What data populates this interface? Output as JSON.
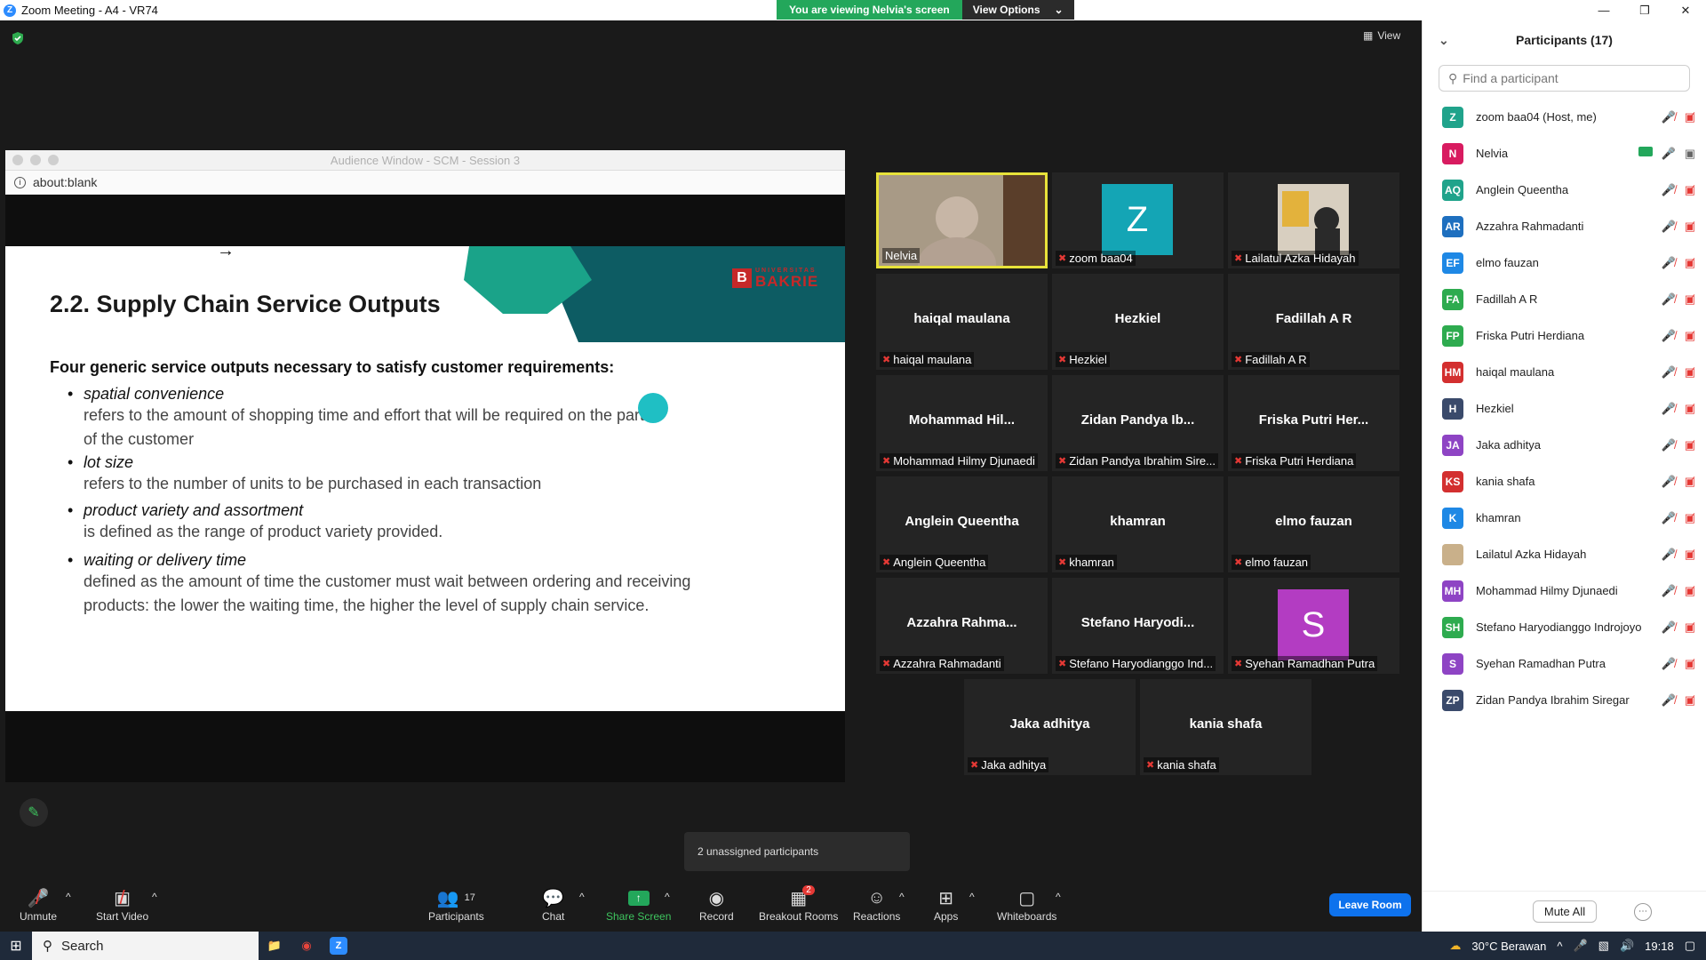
{
  "window": {
    "title": "Zoom Meeting - A4 - VR74"
  },
  "banner": {
    "viewing": "You are viewing Nelvia's screen",
    "options": "View Options"
  },
  "stage": {
    "view_label": "View"
  },
  "audience": {
    "title": "Audience Window - SCM - Session 3",
    "url": "about:blank"
  },
  "slide": {
    "title": "2.2. Supply Chain Service Outputs",
    "subtitle": "Four generic service outputs necessary to satisfy customer requirements:",
    "logo_small": "UNIVERSITAS",
    "logo_word": "BAKRIE",
    "bullets": [
      {
        "head": "spatial convenience",
        "body1": "refers to the amount of shopping time and effort that will be required on the part",
        "body2": "of the customer"
      },
      {
        "head": "lot size",
        "body1": "refers to the number of units to be purchased in each transaction",
        "body2": ""
      },
      {
        "head": "product variety and assortment",
        "body1": "is defined as the range of product variety provided.",
        "body2": ""
      },
      {
        "head": "waiting or delivery time",
        "body1": "defined as the amount of time the customer must wait between ordering and receiving",
        "body2": "products: the lower the waiting time, the higher the level of supply chain service."
      }
    ]
  },
  "tiles": [
    {
      "big": "",
      "label": "Nelvia"
    },
    {
      "big": "Z",
      "label": "zoom baa04"
    },
    {
      "big": "",
      "label": "Lailatul Azka Hidayah"
    },
    {
      "big": "haiqal maulana",
      "label": "haiqal maulana"
    },
    {
      "big": "Hezkiel",
      "label": "Hezkiel"
    },
    {
      "big": "Fadillah A R",
      "label": "Fadillah A R"
    },
    {
      "big": "Mohammad  Hil...",
      "label": "Mohammad Hilmy Djunaedi"
    },
    {
      "big": "Zidan  Pandya  Ib...",
      "label": "Zidan Pandya Ibrahim Sire..."
    },
    {
      "big": "Friska  Putri  Her...",
      "label": "Friska Putri Herdiana"
    },
    {
      "big": "Anglein Queentha",
      "label": "Anglein Queentha"
    },
    {
      "big": "khamran",
      "label": "khamran"
    },
    {
      "big": "elmo fauzan",
      "label": "elmo fauzan"
    },
    {
      "big": "Azzahra  Rahma...",
      "label": "Azzahra Rahmadanti"
    },
    {
      "big": "Stefano  Haryodi...",
      "label": "Stefano Haryodianggo Ind..."
    },
    {
      "big": "S",
      "label": "Syehan Ramadhan Putra"
    },
    {
      "big": "Jaka adhitya",
      "label": "Jaka adhitya"
    },
    {
      "big": "kania shafa",
      "label": "kania shafa"
    }
  ],
  "panel": {
    "title": "Participants (17)",
    "search_placeholder": "Find a participant",
    "participants": [
      {
        "initials": "Z",
        "name": "zoom baa04 (Host, me)",
        "color": "#20a38b"
      },
      {
        "initials": "N",
        "name": "Nelvia",
        "color": "#d81b60"
      },
      {
        "initials": "AQ",
        "name": "Anglein Queentha",
        "color": "#20a38b"
      },
      {
        "initials": "AR",
        "name": "Azzahra Rahmadanti",
        "color": "#1e6fbf"
      },
      {
        "initials": "EF",
        "name": "elmo fauzan",
        "color": "#1e88e5"
      },
      {
        "initials": "FA",
        "name": "Fadillah A R",
        "color": "#2eab4f"
      },
      {
        "initials": "FP",
        "name": "Friska Putri Herdiana",
        "color": "#2eab4f"
      },
      {
        "initials": "HM",
        "name": "haiqal maulana",
        "color": "#d32f2f"
      },
      {
        "initials": "H",
        "name": "Hezkiel",
        "color": "#3a4a6b"
      },
      {
        "initials": "JA",
        "name": "Jaka adhitya",
        "color": "#8e44c4"
      },
      {
        "initials": "KS",
        "name": "kania shafa",
        "color": "#d32f2f"
      },
      {
        "initials": "K",
        "name": "khamran",
        "color": "#1e88e5"
      },
      {
        "initials": "",
        "name": "Lailatul Azka Hidayah",
        "color": "#c9b08a"
      },
      {
        "initials": "MH",
        "name": "Mohammad Hilmy Djunaedi",
        "color": "#8e44c4"
      },
      {
        "initials": "SH",
        "name": "Stefano Haryodianggo Indrojoyo",
        "color": "#2eab4f"
      },
      {
        "initials": "S",
        "name": "Syehan Ramadhan Putra",
        "color": "#8e44c4"
      },
      {
        "initials": "ZP",
        "name": "Zidan Pandya Ibrahim Siregar",
        "color": "#3a4a6b"
      }
    ],
    "mute_all": "Mute All"
  },
  "toolbar": {
    "unmute": "Unmute",
    "start_video": "Start Video",
    "participants": "Participants",
    "participants_count": "17",
    "chat": "Chat",
    "share_screen": "Share Screen",
    "record": "Record",
    "breakout_rooms": "Breakout Rooms",
    "breakout_badge": "2",
    "reactions": "Reactions",
    "apps": "Apps",
    "whiteboards": "Whiteboards",
    "leave_room": "Leave Room",
    "unassigned": "2 unassigned participants"
  },
  "taskbar": {
    "search": "Search",
    "weather": "30°C  Berawan",
    "time": "19:18"
  }
}
